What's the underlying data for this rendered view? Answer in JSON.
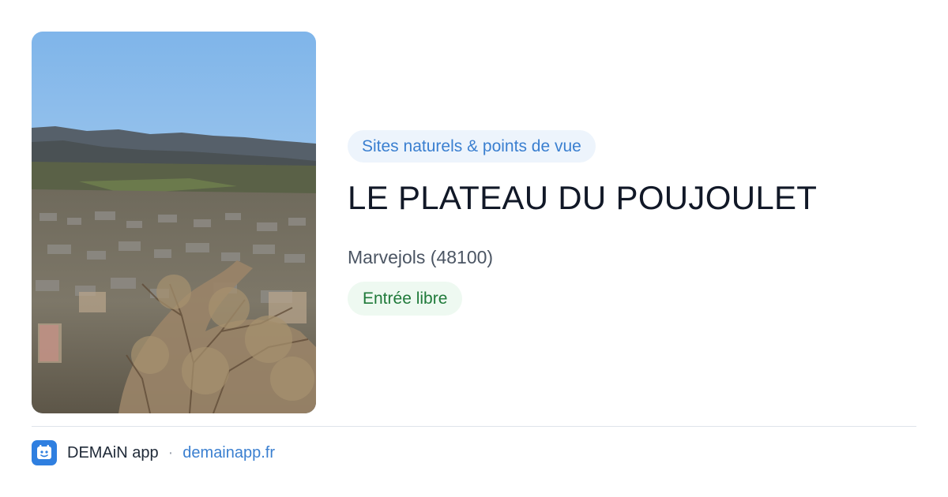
{
  "card": {
    "category": "Sites naturels & points de vue",
    "title": "LE PLATEAU DU POUJOULET",
    "location": "Marvejols (48100)",
    "access": "Entrée libre",
    "image_subject": "aerial view of a town in a valley with hills and bare trees"
  },
  "footer": {
    "app_name": "DEMAiN app",
    "separator": "·",
    "url": "demainapp.fr",
    "logo_icon": "demain-logo-icon"
  },
  "colors": {
    "accent_blue": "#3a7fd0",
    "category_bg": "#edf4fc",
    "access_green": "#1f7a3a",
    "access_bg": "#eef9f1",
    "title": "#111827"
  }
}
